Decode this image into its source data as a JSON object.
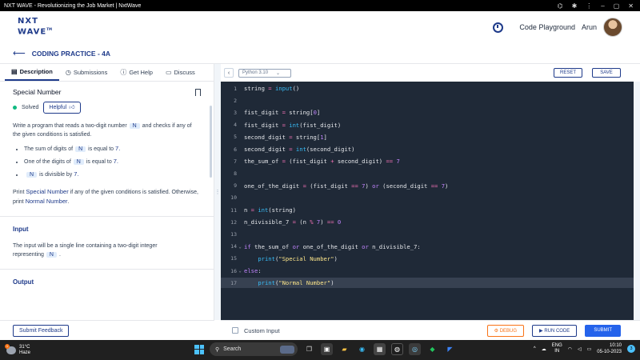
{
  "window": {
    "title": "NXT WAVE - Revolutionizing the Job Market | NxtWave"
  },
  "header": {
    "logo_line1": "NXT",
    "logo_line2": "WAVE",
    "logo_tm": "TM",
    "code_playground": "Code Playground",
    "user_name": "Arun"
  },
  "breadcrumb": {
    "title": "CODING PRACTICE - 4A"
  },
  "tabs": [
    {
      "label": "Description",
      "icon": "document-icon"
    },
    {
      "label": "Submissions",
      "icon": "history-icon"
    },
    {
      "label": "Get Help",
      "icon": "help-circle-icon"
    },
    {
      "label": "Discuss",
      "icon": "chat-icon"
    }
  ],
  "problem": {
    "title": "Special Number",
    "status": "Solved",
    "helpful_label": "Helpful",
    "intro_part1": "Write a program that reads a two-digit number",
    "intro_chip": "N",
    "intro_part2": "and checks if any of the given conditions is satisfied.",
    "rules": [
      {
        "pre": "The sum of digits of",
        "chip": "N",
        "post": "is equal to",
        "hl": "7."
      },
      {
        "pre": "One of the digits of",
        "chip": "N",
        "post": "is equal to",
        "hl": "7."
      },
      {
        "pre": "",
        "chip": "N",
        "post": "is divisible by",
        "hl": "7."
      }
    ],
    "print_part1": "Print",
    "print_hl1": "Special Number",
    "print_part2": "if any of the given conditions is satisfied. Otherwise, print",
    "print_hl2": "Normal Number",
    "print_part3": ".",
    "input_heading": "Input",
    "input_text": "The input will be a single line containing a two-digit integer representing",
    "input_chip": "N",
    "input_end": ".",
    "output_heading": "Output"
  },
  "left_footer": {
    "submit_feedback": "Submit Feedback"
  },
  "editor_toolbar": {
    "language": "Python 3.10",
    "reset": "RESET",
    "save": "SAVE"
  },
  "code_lines": [
    {
      "n": "1",
      "text": "string = input()",
      "fold": ""
    },
    {
      "n": "2",
      "text": "",
      "fold": ""
    },
    {
      "n": "3",
      "text": "fist_digit = string[0]",
      "fold": ""
    },
    {
      "n": "4",
      "text": "fist_digit = int(fist_digit)",
      "fold": ""
    },
    {
      "n": "5",
      "text": "second_digit = string[1]",
      "fold": ""
    },
    {
      "n": "6",
      "text": "second_digit = int(second_digit)",
      "fold": ""
    },
    {
      "n": "7",
      "text": "the_sum_of = (fist_digit + second_digit) == 7",
      "fold": ""
    },
    {
      "n": "8",
      "text": "",
      "fold": ""
    },
    {
      "n": "9",
      "text": "one_of_the_digit = (fist_digit == 7) or (second_digit == 7)",
      "fold": ""
    },
    {
      "n": "10",
      "text": "",
      "fold": ""
    },
    {
      "n": "11",
      "text": "n = int(string)",
      "fold": ""
    },
    {
      "n": "12",
      "text": "n_divisible_7 = (n % 7) == 0",
      "fold": ""
    },
    {
      "n": "13",
      "text": "",
      "fold": ""
    },
    {
      "n": "14",
      "text": "if the_sum_of or one_of_the_digit or n_divisible_7:",
      "fold": "⌄"
    },
    {
      "n": "15",
      "text": "    print(\"Special Number\")",
      "fold": ""
    },
    {
      "n": "16",
      "text": "else:",
      "fold": "⌄"
    },
    {
      "n": "17",
      "text": "    print(\"Normal Number\")",
      "fold": ""
    }
  ],
  "current_line": "17",
  "editor_footer": {
    "custom_input": "Custom Input",
    "debug": "DEBUG",
    "run_code": "RUN CODE",
    "submit": "SUBMIT"
  },
  "taskbar": {
    "temperature": "31°C",
    "weather": "Haze",
    "weather_badge": "1",
    "search": "Search",
    "lang_line1": "ENG",
    "lang_line2": "IN",
    "time": "10:10",
    "date": "05-10-2023",
    "notification_count": "3"
  }
}
